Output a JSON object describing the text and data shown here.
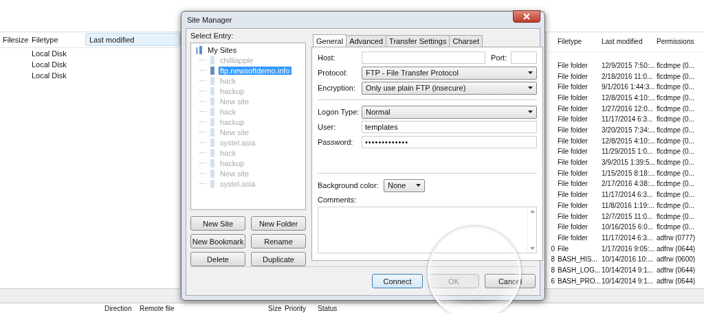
{
  "local_pane": {
    "columns": [
      {
        "label": "Filesize",
        "selected": false
      },
      {
        "label": "Filetype",
        "selected": false
      },
      {
        "label": "Last modified",
        "selected": true
      }
    ],
    "rows": [
      {
        "filetype": "Local Disk"
      },
      {
        "filetype": "Local Disk"
      },
      {
        "filetype": "Local Disk"
      }
    ]
  },
  "remote_pane": {
    "columns": [
      "Filetype",
      "Last modified",
      "Permissions"
    ],
    "rows": [
      {
        "filetype": "File folder",
        "modified": "12/9/2015 7:50:...",
        "permissions": "flcdmpe (0..."
      },
      {
        "filetype": "File folder",
        "modified": "2/18/2016 11:0...",
        "permissions": "flcdmpe (0..."
      },
      {
        "filetype": "File folder",
        "modified": "9/1/2016 1:44:3...",
        "permissions": "flcdmpe (0..."
      },
      {
        "filetype": "File folder",
        "modified": "12/8/2015 4:10:...",
        "permissions": "flcdmpe (0..."
      },
      {
        "filetype": "File folder",
        "modified": "1/27/2016 12:0...",
        "permissions": "flcdmpe (0..."
      },
      {
        "filetype": "File folder",
        "modified": "11/17/2014 6:3...",
        "permissions": "flcdmpe (0..."
      },
      {
        "filetype": "File folder",
        "modified": "3/20/2015 7:34:...",
        "permissions": "flcdmpe (0..."
      },
      {
        "filetype": "File folder",
        "modified": "12/8/2015 4:10:...",
        "permissions": "flcdmpe (0..."
      },
      {
        "filetype": "File folder",
        "modified": "11/29/2015 1:0...",
        "permissions": "flcdmpe (0..."
      },
      {
        "filetype": "File folder",
        "modified": "3/9/2015 1:39:5...",
        "permissions": "flcdmpe (0..."
      },
      {
        "filetype": "File folder",
        "modified": "1/15/2015 8:18:...",
        "permissions": "flcdmpe (0..."
      },
      {
        "filetype": "File folder",
        "modified": "2/17/2016 4:38:...",
        "permissions": "flcdmpe (0..."
      },
      {
        "filetype": "File folder",
        "modified": "11/17/2014 6:3...",
        "permissions": "flcdmpe (0..."
      },
      {
        "filetype": "File folder",
        "modified": "11/8/2016 1:19:...",
        "permissions": "flcdmpe (0..."
      },
      {
        "filetype": "File folder",
        "modified": "12/7/2015 11:0...",
        "permissions": "flcdmpe (0..."
      },
      {
        "filetype": "File folder",
        "modified": "10/16/2015 6:0...",
        "permissions": "flcdmpe (0..."
      },
      {
        "filetype": "File folder",
        "modified": "11/17/2014 6:3...",
        "permissions": "adfrw (0777)"
      },
      {
        "size": "0",
        "filetype": "File",
        "modified": "1/17/2016 9:05:...",
        "permissions": "adfrw (0644)"
      },
      {
        "size": "8",
        "filetype": "BASH_HIS...",
        "modified": "10/14/2016 10:...",
        "permissions": "adfrw (0600)"
      },
      {
        "size": "8",
        "filetype": "BASH_LOG...",
        "modified": "10/14/2014 9:1...",
        "permissions": "adfrw (0644)"
      },
      {
        "size": "6",
        "filetype": "BASH_PRO...",
        "modified": "10/14/2014 9:1...",
        "permissions": "adfrw (0644)"
      }
    ]
  },
  "queue_columns": [
    "Direction",
    "Remote file",
    "Size",
    "Priority",
    "Status"
  ],
  "dialog": {
    "title": "Site Manager",
    "select_entry_label": "Select Entry:",
    "tree": {
      "label": "My Sites",
      "children": [
        {
          "label": "chilliapple",
          "selected": false
        },
        {
          "label": "ftp.newsoftdemo.info",
          "selected": true
        },
        {
          "label": "hack",
          "selected": false
        },
        {
          "label": "hackup",
          "selected": false
        },
        {
          "label": "New site",
          "selected": false
        },
        {
          "label": "hack",
          "selected": false
        },
        {
          "label": "hackup",
          "selected": false
        },
        {
          "label": "New site",
          "selected": false
        },
        {
          "label": "systel.asia",
          "selected": false
        },
        {
          "label": "hack",
          "selected": false
        },
        {
          "label": "hackup",
          "selected": false
        },
        {
          "label": "New site",
          "selected": false
        },
        {
          "label": "systel.asia",
          "selected": false
        }
      ]
    },
    "entry_buttons": [
      "New Site",
      "New Folder",
      "New Bookmark",
      "Rename",
      "Delete",
      "Duplicate"
    ],
    "tabs": [
      {
        "label": "General",
        "selected": true
      },
      {
        "label": "Advanced",
        "selected": false
      },
      {
        "label": "Transfer Settings",
        "selected": false
      },
      {
        "label": "Charset",
        "selected": false
      }
    ],
    "host": {
      "label": "Host:"
    },
    "port": {
      "label": "Port:"
    },
    "fields": [
      {
        "kind": "select",
        "label": "Protocol:",
        "value": "FTP - File Transfer Protocol"
      },
      {
        "kind": "select",
        "label": "Encryption:",
        "value": "Only use plain FTP (insecure)"
      },
      {
        "kind": "separator"
      },
      {
        "kind": "select",
        "label": "Logon Type:",
        "value": "Normal"
      },
      {
        "kind": "text",
        "label": "User:",
        "value": "templates"
      },
      {
        "kind": "password",
        "label": "Password:",
        "value": "•••••••••••••"
      }
    ],
    "background_color": {
      "label": "Background color:",
      "value": "None"
    },
    "comments": {
      "label": "Comments:"
    },
    "buttons": [
      {
        "label": "Connect",
        "disabled": false
      },
      {
        "label": "OK",
        "disabled": true
      },
      {
        "label": "Cancel",
        "disabled": false
      }
    ]
  }
}
